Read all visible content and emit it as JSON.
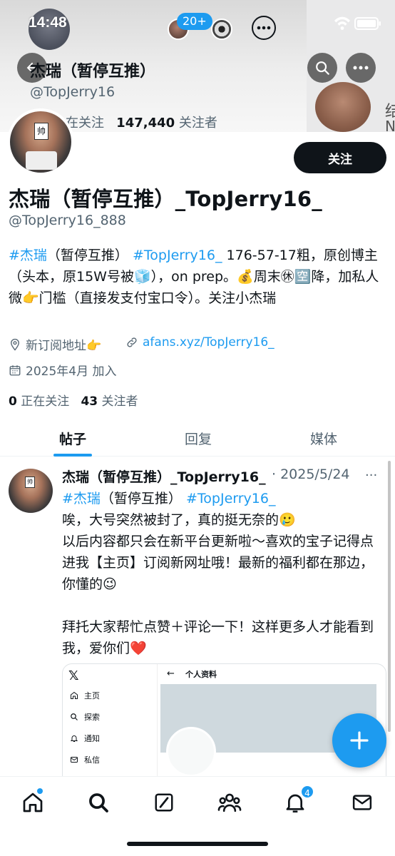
{
  "status_bar": {
    "time": "14:48",
    "badge_count": "20+"
  },
  "header": {
    "name": "杰瑞（暂停互推）",
    "handle": "@TopJerry16",
    "following_partial": "在关注",
    "followers_count": "147,440",
    "followers_label": "关注者",
    "banner_text_1": "结",
    "banner_text_2": "N"
  },
  "profile": {
    "follow_button": "关注",
    "display_name": "杰瑞（暂停互推）_TopJerry16_",
    "handle": "@TopJerry16_888",
    "bio": {
      "hashtag1": "#杰瑞",
      "text1": "（暂停互推）",
      "hashtag2": "#TopJerry16_",
      "text2": "176-57-17粗，原创博主（头本，原15W号被🧊），on prep。💰周末㊡🈳降，加私人微👉门槛（直接发支付宝口令）。关注小杰瑞"
    },
    "location": "新订阅地址👉",
    "website": "afans.xyz/TopJerry16_",
    "joined": "2025年4月 加入",
    "following_count": "0",
    "following_label": "正在关注",
    "followers_count": "43",
    "followers_label": "关注者",
    "avatar_sticker": "帅"
  },
  "tabs": [
    {
      "label": "帖子",
      "active": true
    },
    {
      "label": "回复",
      "active": false
    },
    {
      "label": "媒体",
      "active": false
    }
  ],
  "post": {
    "author": "杰瑞（暂停互推）_TopJerry16_",
    "date": "· 2025/5/24",
    "more": "···",
    "hashtag1": "#杰瑞",
    "tag_text": "（暂停互推）",
    "hashtag2": "#TopJerry16_",
    "line1": "唉，大号突然被封了，真的挺无奈的🥲",
    "line2": "以后内容都只会在新平台更新啦～喜欢的宝子记得点进我【主页】订阅新网址哦！最新的福利都在那边，你懂的😉",
    "line3": "拜托大家帮忙点赞＋评论一下！这样更多人才能看到我，爱你们❤️",
    "embed": {
      "logo": "𝕏",
      "back": "←",
      "page_title": "个人资料",
      "nav_items": [
        "主页",
        "探索",
        "通知",
        "私信"
      ]
    }
  },
  "bottom_nav": {
    "notifications_badge": "4"
  },
  "colors": {
    "accent": "#1d9bf0",
    "text": "#0f1419",
    "muted": "#536471"
  }
}
